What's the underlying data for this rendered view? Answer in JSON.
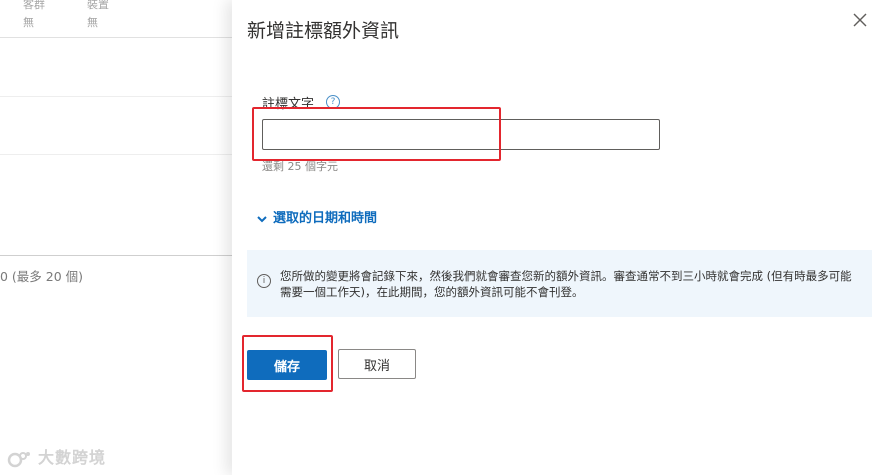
{
  "background": {
    "columns": [
      {
        "header": "客群",
        "value": "無"
      },
      {
        "header": "裝置",
        "value": "無"
      }
    ],
    "count_text": "0 (最多 20 個)",
    "watermark": "大數跨境"
  },
  "panel": {
    "title": "新增註標額外資訊",
    "field": {
      "label": "註標文字",
      "help_icon": "?",
      "value": "",
      "placeholder": "",
      "remaining": "還剩 25 個字元"
    },
    "date_toggle": "選取的日期和時間",
    "info": {
      "icon": "i",
      "text": "您所做的變更將會記錄下來，然後我們就會審查您新的額外資訊。審查通常不到三小時就會完成 (但有時最多可能需要一個工作天)，在此期間，您的額外資訊可能不會刊登。"
    },
    "buttons": {
      "save": "儲存",
      "cancel": "取消"
    }
  },
  "colors": {
    "accent": "#0f6cbd",
    "annotation": "#e3262e",
    "info_background": "#eff6fc"
  }
}
